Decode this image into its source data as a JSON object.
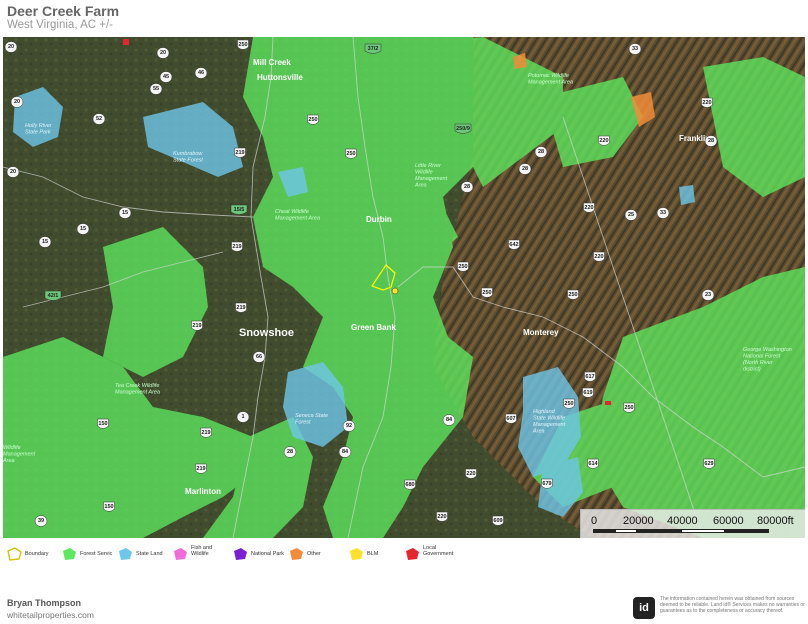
{
  "header": {
    "title": "Deer Creek Farm",
    "subtitle": "West Virginia,  AC +/-"
  },
  "map": {
    "towns": [
      {
        "name": "Mill Creek",
        "size": "normal"
      },
      {
        "name": "Huttonsville",
        "size": "normal"
      },
      {
        "name": "Franklin",
        "size": "normal"
      },
      {
        "name": "Durbin",
        "size": "normal"
      },
      {
        "name": "Green Bank",
        "size": "normal"
      },
      {
        "name": "Snowshoe",
        "size": "big"
      },
      {
        "name": "Monterey",
        "size": "normal"
      },
      {
        "name": "Marlinton",
        "size": "normal"
      }
    ],
    "area_labels": [
      {
        "lines": [
          "Holly River",
          "State Park"
        ],
        "kind": "blue"
      },
      {
        "lines": [
          "Kumbrabow",
          "State Forest"
        ],
        "kind": "blue"
      },
      {
        "lines": [
          "Cheat Wildlife",
          "Management Area"
        ],
        "kind": "green"
      },
      {
        "lines": [
          "Little River",
          "Wildlife",
          "Management",
          "Area"
        ],
        "kind": "green"
      },
      {
        "lines": [
          "Potomac Wildlife",
          "Management Area"
        ],
        "kind": "green"
      },
      {
        "lines": [
          "Tea Creek Wildlife",
          "Management Area"
        ],
        "kind": "green"
      },
      {
        "lines": [
          "Seneca State",
          "Forest"
        ],
        "kind": "blue"
      },
      {
        "lines": [
          "Highland",
          "State Wildlife",
          "Management",
          "Area"
        ],
        "kind": "blue"
      },
      {
        "lines": [
          "George Washington",
          "National Forest",
          "(North River",
          "district)"
        ],
        "kind": "green"
      },
      {
        "lines": [
          "Wildlife",
          "Management",
          "Area"
        ],
        "kind": "green"
      }
    ],
    "route_shields": [
      "33",
      "250",
      "20",
      "46",
      "55",
      "52",
      "20",
      "250",
      "219",
      "250",
      "15",
      "15/5",
      "15",
      "219",
      "15",
      "42/1",
      "219",
      "66",
      "219",
      "1",
      "219",
      "219",
      "39",
      "150",
      "92",
      "84",
      "28",
      "84",
      "607",
      "220",
      "609",
      "680",
      "28",
      "28",
      "250",
      "642",
      "250",
      "250",
      "220",
      "23",
      "220",
      "25",
      "33",
      "220",
      "28",
      "220",
      "250",
      "617",
      "619",
      "614",
      "629",
      "250",
      "679",
      "220",
      "37/2",
      "250/9",
      "20",
      "28",
      "150",
      "45",
      "20",
      "55"
    ],
    "scalebar": {
      "ticks": [
        "0",
        "20000",
        "40000",
        "60000",
        "80000ft"
      ]
    },
    "colors": {
      "forest_service": "#5ee85e",
      "state_land": "#6ec6e8",
      "boundary": "#ffff00"
    }
  },
  "legend": [
    {
      "label": "Boundary",
      "icon": "boundary-outline",
      "color": "#d4c200"
    },
    {
      "label": "Forest Servic",
      "icon": "polygon-swatch",
      "color": "#5ee85e"
    },
    {
      "label": "State Land",
      "icon": "polygon-swatch",
      "color": "#6ec6e8"
    },
    {
      "label": "Fish and\nWildlife",
      "icon": "polygon-swatch",
      "color": "#f26cd8"
    },
    {
      "label": "National Park",
      "icon": "polygon-swatch",
      "color": "#7a1fd6"
    },
    {
      "label": "Other",
      "icon": "polygon-swatch",
      "color": "#f28c3a"
    },
    {
      "label": "BLM",
      "icon": "polygon-swatch",
      "color": "#ffe02a"
    },
    {
      "label": "Local\nGovernment",
      "icon": "polygon-swatch",
      "color": "#e6262e"
    }
  ],
  "footer": {
    "agent_name": "Bryan Thompson",
    "agent_site": "whitetailproperties.com",
    "logo_text": "id",
    "disclaimer": "The information contained herein was obtained from sources deemed to be reliable. Land id® Services makes no warranties or guarantees as to the completeness or accuracy thereof."
  }
}
